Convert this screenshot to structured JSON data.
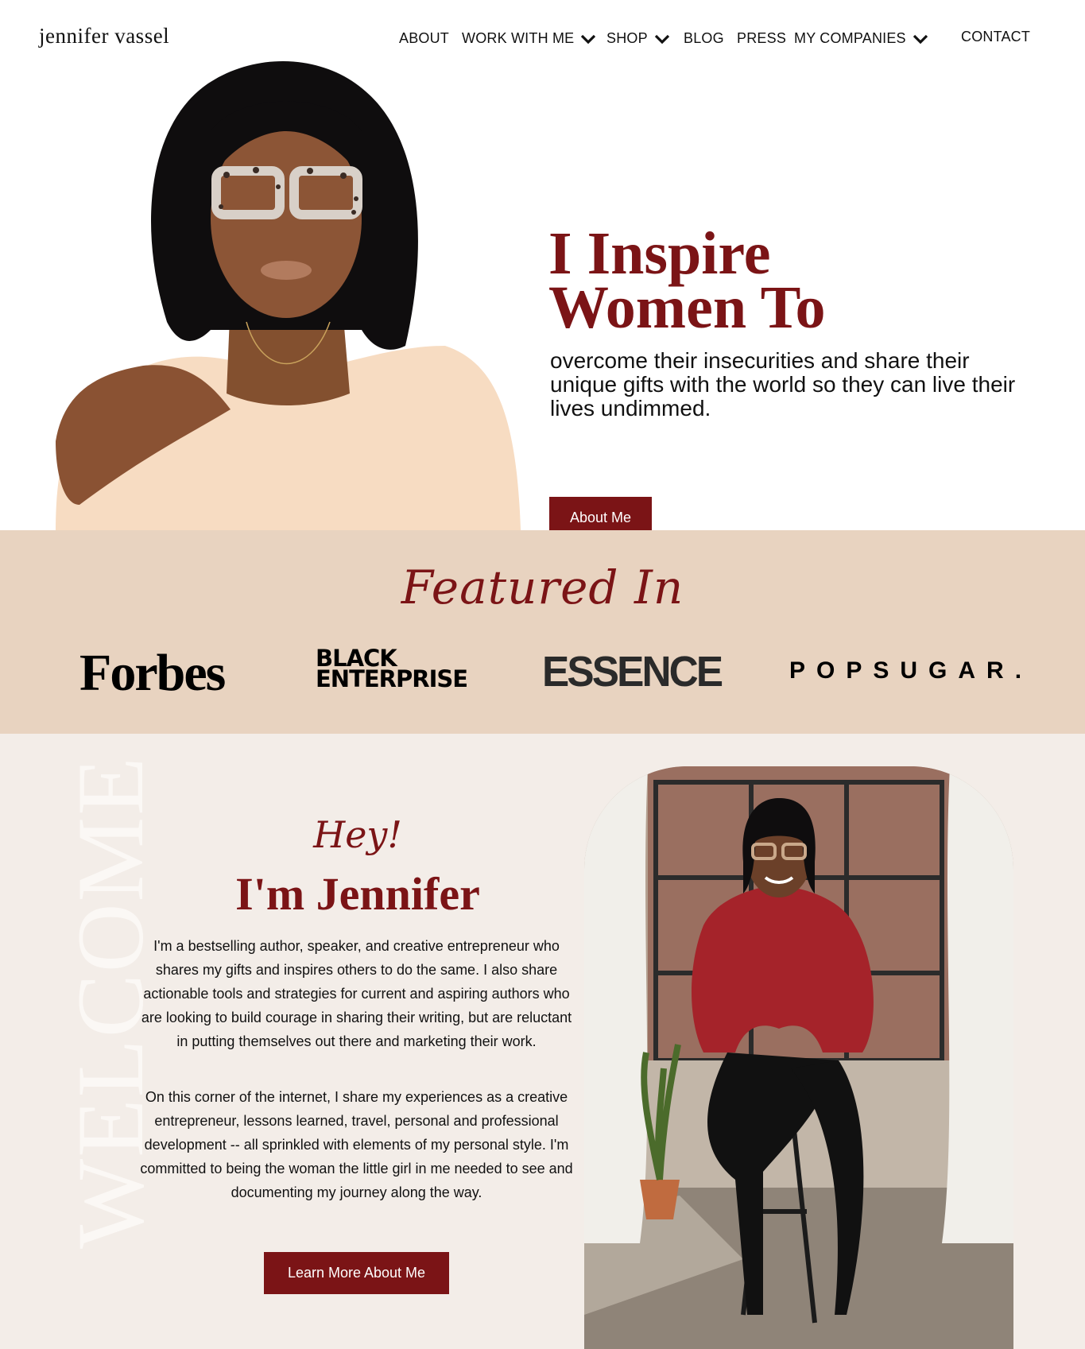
{
  "header": {
    "logo": "jennifer vassel",
    "nav": [
      {
        "label": "ABOUT",
        "dropdown": false
      },
      {
        "label": "WORK WITH ME",
        "dropdown": true
      },
      {
        "label": "SHOP",
        "dropdown": true
      },
      {
        "label": "BLOG",
        "dropdown": false
      },
      {
        "label": "PRESS",
        "dropdown": false
      },
      {
        "label": "MY COMPANIES",
        "dropdown": true
      },
      {
        "label": "CONTACT",
        "dropdown": false
      }
    ]
  },
  "hero": {
    "title_line1": "I Inspire",
    "title_line2": "Women To",
    "subtitle": "overcome their insecurities and share their unique gifts with the world so they can live their lives undimmed.",
    "button_label": "About Me"
  },
  "featured": {
    "title": "Featured In",
    "logos": {
      "forbes": "Forbes",
      "black_enterprise_line1": "BLACK",
      "black_enterprise_line2": "ENTERPRISE",
      "essence": "ESSENCE",
      "popsugar": "POPSUGAR."
    }
  },
  "welcome": {
    "vertical_word": "WELCOME",
    "greeting": "Hey!",
    "heading": "I'm Jennifer",
    "paragraph1": "I'm a bestselling author, speaker, and creative entrepreneur who shares my gifts and inspires others to do the same. I also share actionable tools and strategies for current and aspiring authors who are looking to build courage in sharing their writing, but are reluctant in putting themselves out there and marketing their work.",
    "paragraph2": "On this corner of the internet, I share my experiences as a creative entrepreneur, lessons learned, travel, personal and professional development -- all sprinkled with elements of my personal style. I'm committed to being the woman the little girl in me needed to see and documenting my journey along the way.",
    "button_label": "Learn More About Me"
  },
  "colors": {
    "brand": "#7b1416",
    "featured_bg": "#e8d3c0",
    "welcome_bg": "#f3ede8"
  },
  "icons": [
    "chevron-down-icon"
  ]
}
